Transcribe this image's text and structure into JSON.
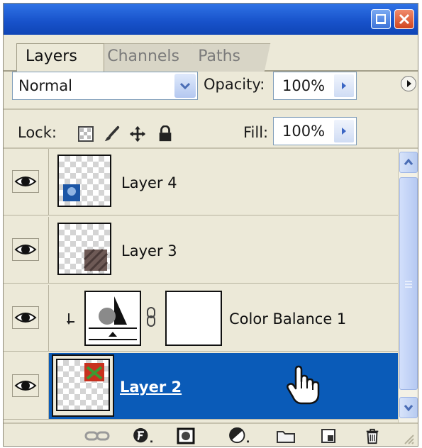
{
  "tabs": [
    {
      "label": "Layers",
      "active": true
    },
    {
      "label": "Channels",
      "active": false
    },
    {
      "label": "Paths",
      "active": false
    }
  ],
  "controls": {
    "blend_mode": "Normal",
    "opacity_label": "Opacity:",
    "opacity_value": "100%",
    "lock_label": "Lock:",
    "fill_label": "Fill:",
    "fill_value": "100%"
  },
  "layers": [
    {
      "name": "Layer 4",
      "visible": true,
      "selected": false
    },
    {
      "name": "Layer 3",
      "visible": true,
      "selected": false
    },
    {
      "name": "Color Balance 1",
      "visible": true,
      "selected": false,
      "adjustment": true
    },
    {
      "name": "Layer 2",
      "visible": true,
      "selected": true
    }
  ],
  "colors": {
    "titlebar": "#1f5fd6",
    "selection": "#0a5bb8",
    "panel": "#ece9d8"
  },
  "icons": {
    "lock_icons": [
      "lock-transparency-icon",
      "lock-brush-icon",
      "lock-move-icon",
      "lock-all-icon"
    ],
    "bottom_icons": [
      "link-layers-icon",
      "layer-style-icon",
      "layer-mask-icon",
      "adjustment-layer-icon",
      "new-group-icon",
      "new-layer-icon",
      "delete-layer-icon"
    ]
  }
}
